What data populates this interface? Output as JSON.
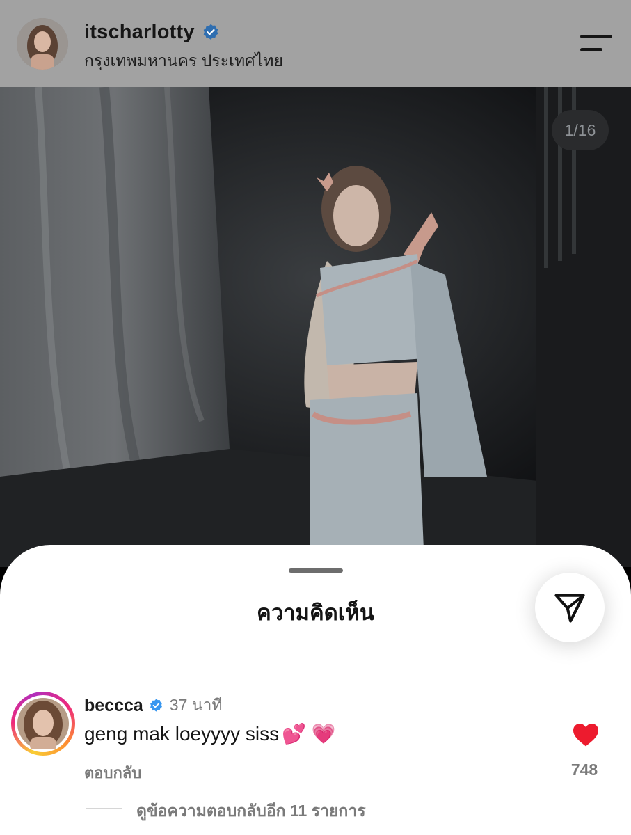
{
  "header": {
    "username": "itscharlotty",
    "location": "กรุงเทพมหานคร ประเทศไทย",
    "verified_icon": "verified-badge-icon",
    "menu_icon": "menu-icon"
  },
  "post": {
    "counter": "1/16",
    "image_alt": "photo"
  },
  "comments": {
    "title": "ความคิดเห็น",
    "share_icon": "send-icon",
    "items": [
      {
        "username": "beccca",
        "time": "37 นาที",
        "text": "geng mak loeyyyy siss",
        "emoji": "💕 💗",
        "reply_label": "ตอบกลับ",
        "likes": "748",
        "more_replies": "ดูข้อความตอบกลับอีก 11 รายการ"
      }
    ]
  },
  "colors": {
    "verified": "#3897f0",
    "like": "#ed1b2e",
    "header_bg": "#a2a2a2"
  }
}
